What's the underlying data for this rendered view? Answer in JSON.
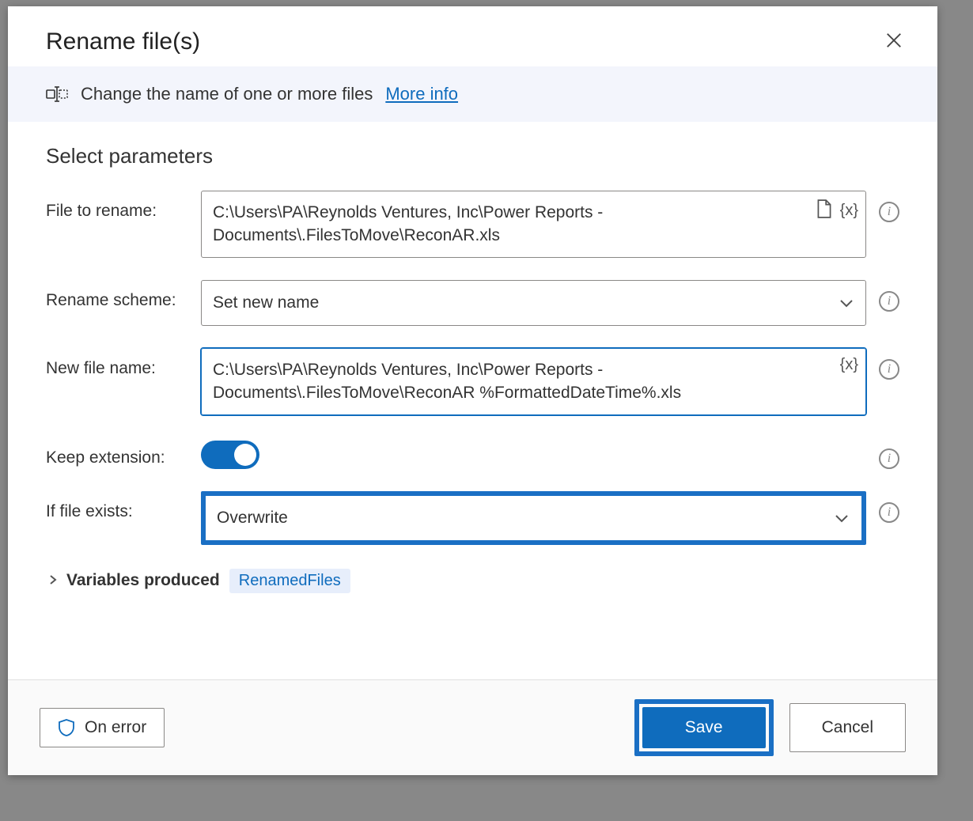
{
  "dialog": {
    "title": "Rename file(s)",
    "description": "Change the name of one or more files",
    "more_info": "More info"
  },
  "section_heading": "Select parameters",
  "params": {
    "file_to_rename": {
      "label": "File to rename:",
      "value": "C:\\Users\\PA\\Reynolds Ventures, Inc\\Power Reports - Documents\\.FilesToMove\\ReconAR.xls"
    },
    "rename_scheme": {
      "label": "Rename scheme:",
      "value": "Set new name"
    },
    "new_file_name": {
      "label": "New file name:",
      "value": "C:\\Users\\PA\\Reynolds Ventures, Inc\\Power Reports - Documents\\.FilesToMove\\ReconAR %FormattedDateTime%.xls"
    },
    "keep_extension": {
      "label": "Keep extension:",
      "value": true
    },
    "if_file_exists": {
      "label": "If file exists:",
      "value": "Overwrite"
    }
  },
  "variables_produced": {
    "label": "Variables produced",
    "items": [
      "RenamedFiles"
    ]
  },
  "footer": {
    "on_error": "On error",
    "save": "Save",
    "cancel": "Cancel"
  }
}
